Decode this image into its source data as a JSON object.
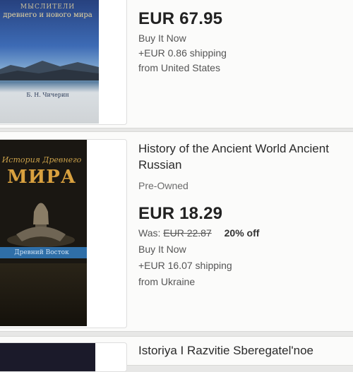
{
  "listings": [
    {
      "cover": {
        "heading_line1": "МЫСЛИТЕЛИ",
        "heading_line2": "древнего и нового мира",
        "author": "Б. Н. Чичерин"
      },
      "price": "EUR 67.95",
      "format": "Buy It Now",
      "shipping": "+EUR 0.86 shipping",
      "location": "from United States"
    },
    {
      "cover": {
        "title_line1": "История Древнего",
        "title_line2": "МИРА",
        "band": "Древний Восток"
      },
      "title_line1": "History of the Ancient World Ancient",
      "title_line2": "Russian",
      "condition": "Pre-Owned",
      "price": "EUR 18.29",
      "was_label": "Was:",
      "was_price": "EUR 22.87",
      "discount": "20% off",
      "format": "Buy It Now",
      "shipping": "+EUR 16.07 shipping",
      "location": "from Ukraine"
    },
    {
      "title_line1": "Istoriya I Razvitie Sberegatel'noe"
    }
  ]
}
